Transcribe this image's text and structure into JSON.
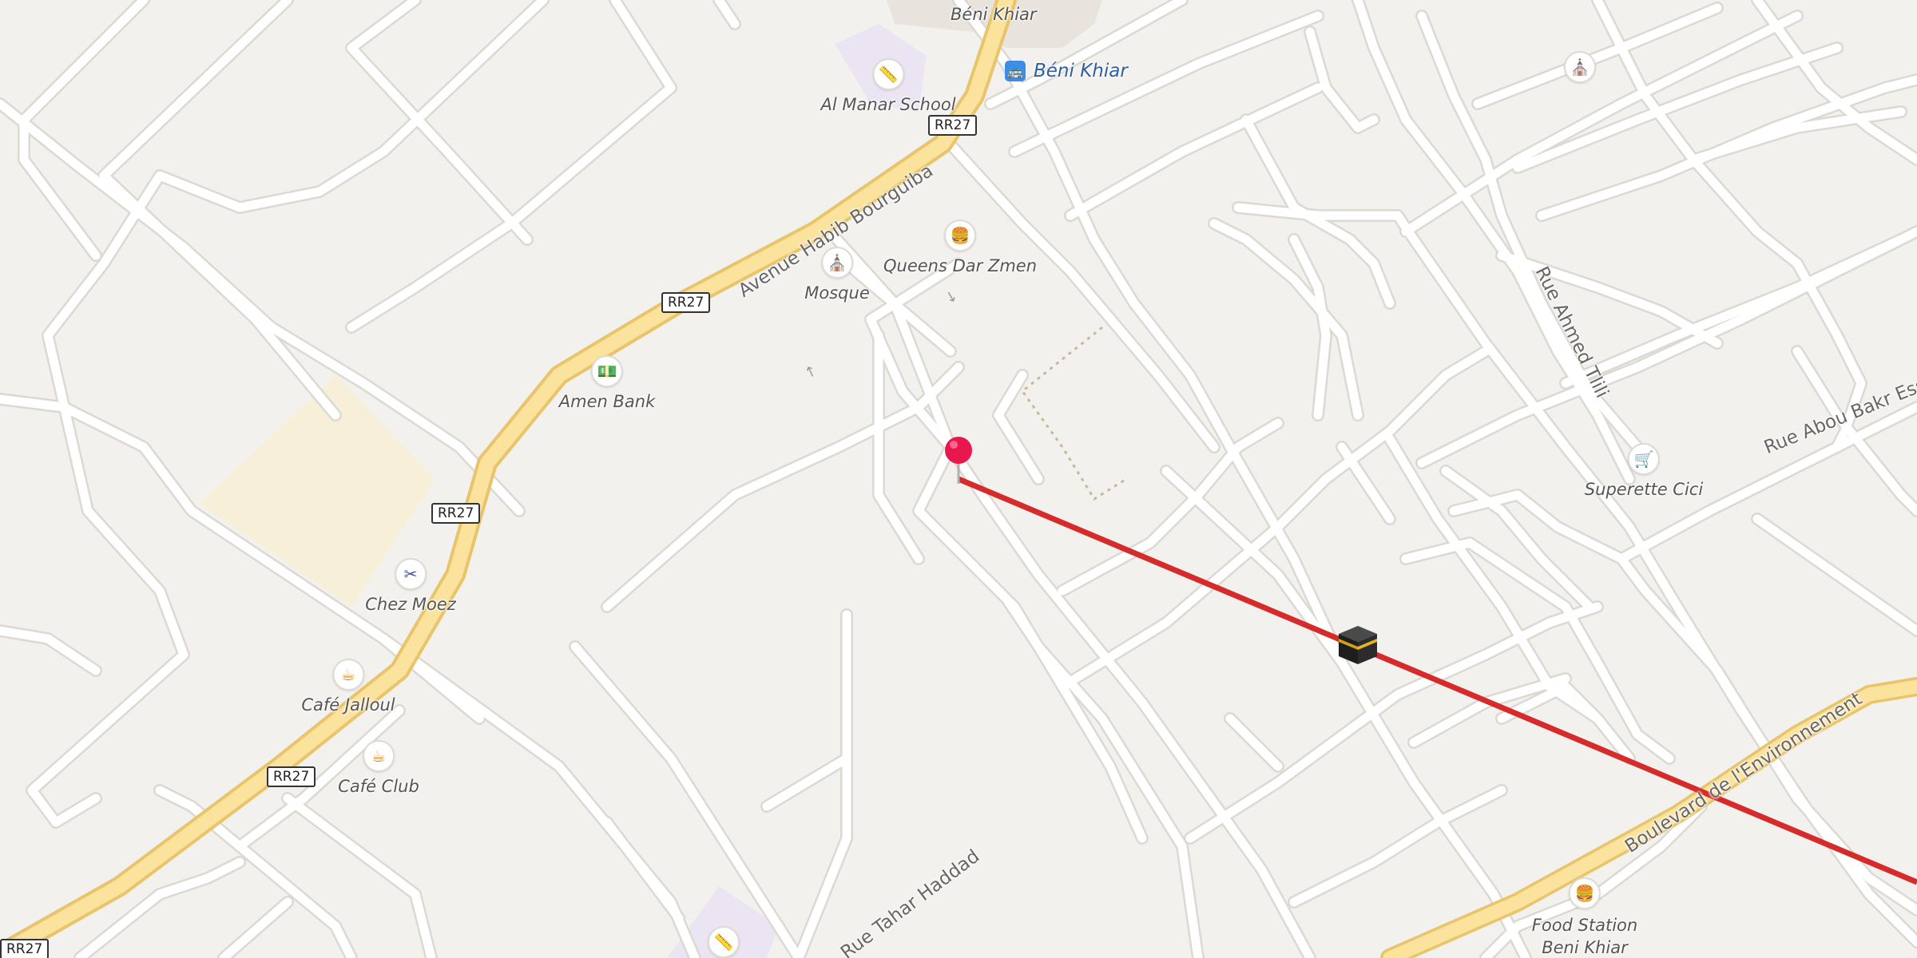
{
  "map": {
    "colors": {
      "background": "#f3f1ee",
      "road": "#ffffff",
      "road_casing": "#dcd8d2",
      "main_road": "#fbe29d",
      "main_road_casing": "#e8c46b",
      "route_line": "#d62b2b",
      "pin": "#e8184f"
    },
    "transit": {
      "label": "Béni Khiar",
      "icon": "bus-icon"
    },
    "place_label": "Béni Khiar",
    "shields": [
      "RR27",
      "RR27",
      "RR27",
      "RR27",
      "RR27"
    ],
    "streets": {
      "avenue": "Avenue Habib Bourguiba",
      "ahmed_tlili": "Rue Ahmed Tlili",
      "abou_bakr": "Rue Abou Bakr Essi",
      "tahar_haddad": "Rue Tahar Haddad",
      "boulevard": "Boulevard de l'Environnement"
    },
    "pois": [
      {
        "label": "Al Manar School",
        "icon": "school-icon"
      },
      {
        "label": "Queens Dar Zmen",
        "icon": "burger-icon"
      },
      {
        "label": "Mosque",
        "icon": "mosque-icon"
      },
      {
        "label": "Amen Bank",
        "icon": "bank-icon"
      },
      {
        "label": "Chez Moez",
        "icon": "scissors-icon"
      },
      {
        "label": "Café Jalloul",
        "icon": "cafe-icon"
      },
      {
        "label": "Café Club",
        "icon": "cafe-icon"
      },
      {
        "label": "Superette Cici",
        "icon": "cart-icon"
      },
      {
        "label": "Food Station\nBeni Khiar",
        "icon": "burger-icon"
      },
      {
        "label": "",
        "icon": "mosque-icon"
      },
      {
        "label": "",
        "icon": "school-icon"
      }
    ],
    "markers": {
      "pin": "location-pin-icon",
      "qibla": "kaaba-icon"
    }
  }
}
